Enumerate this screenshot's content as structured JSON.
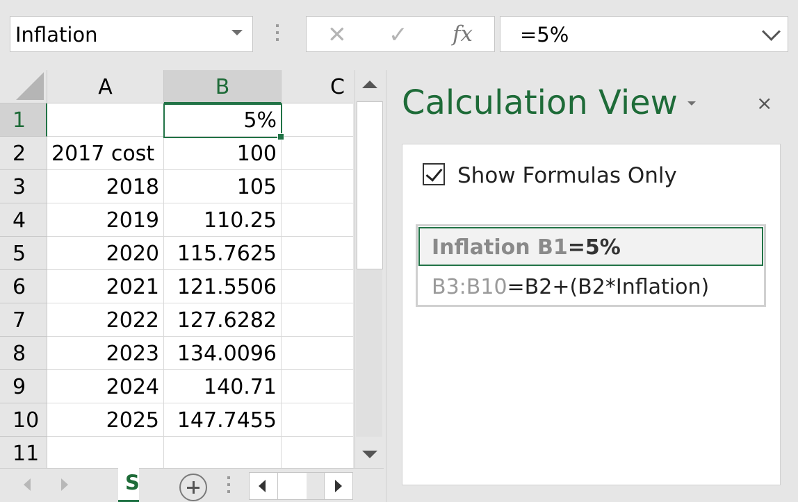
{
  "formula_bar": {
    "name_box": "Inflation",
    "cancel_glyph": "✕",
    "enter_glyph": "✓",
    "fx_label": "fx",
    "formula": "=5%"
  },
  "grid": {
    "column_headers": [
      "A",
      "B",
      "C"
    ],
    "row_headers": [
      "1",
      "2",
      "3",
      "4",
      "5",
      "6",
      "7",
      "8",
      "9",
      "10",
      "11"
    ],
    "rows": [
      [
        "",
        "5%"
      ],
      [
        "2017 cost",
        "100"
      ],
      [
        "2018",
        "105"
      ],
      [
        "2019",
        "110.25"
      ],
      [
        "2020",
        "115.7625"
      ],
      [
        "2021",
        "121.5506"
      ],
      [
        "2022",
        "127.6282"
      ],
      [
        "2023",
        "134.0096"
      ],
      [
        "2024",
        "140.71"
      ],
      [
        "2025",
        "147.7455"
      ],
      [
        "",
        ""
      ]
    ]
  },
  "sheet_tabs": {
    "active_label": "S"
  },
  "pane": {
    "title": "Calculation View",
    "close_glyph": "×",
    "checkbox_label": "Show Formulas Only",
    "checkbox_checked": true,
    "formulas": [
      {
        "ref": "Inflation B1",
        "expr": "=5%"
      },
      {
        "ref": "B3:B10",
        "expr": "=B2+(B2*Inflation)"
      }
    ]
  },
  "colors": {
    "accent": "#217346",
    "title": "#1e6b38"
  }
}
